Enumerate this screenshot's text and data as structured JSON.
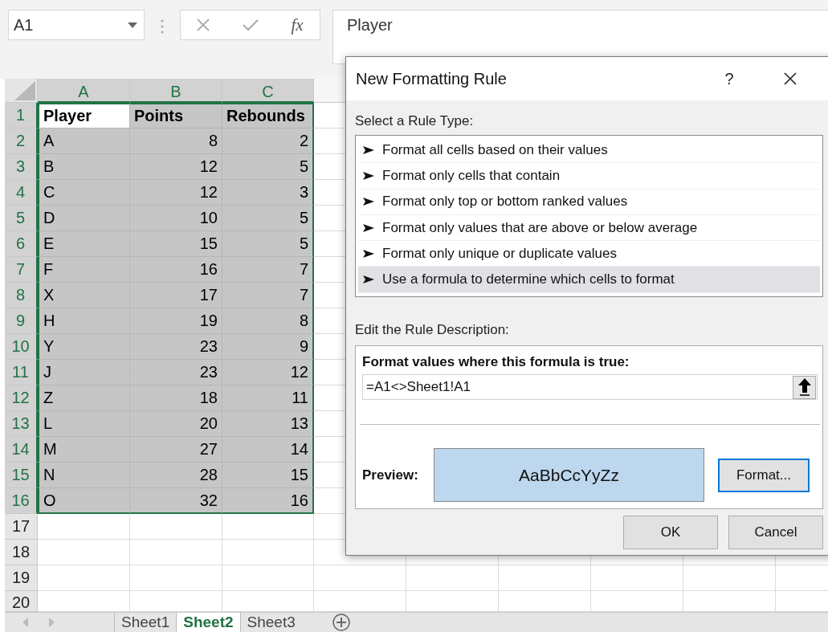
{
  "name_box": {
    "value": "A1"
  },
  "formula_bar": {
    "function_label": "fx",
    "value": "Player"
  },
  "sheet": {
    "columns": [
      {
        "label": "A",
        "selected": true
      },
      {
        "label": "B",
        "selected": true
      },
      {
        "label": "C",
        "selected": true
      }
    ],
    "rows": [
      {
        "number": "1",
        "selected": true,
        "kind": "header",
        "cells": [
          {
            "text": "Player",
            "kind": "text",
            "active": true
          },
          {
            "text": "Points",
            "kind": "text",
            "active": false
          },
          {
            "text": "Rebounds",
            "kind": "text",
            "active": false
          }
        ]
      },
      {
        "number": "2",
        "selected": true,
        "kind": "data",
        "cells": [
          {
            "text": "A",
            "kind": "text",
            "active": false
          },
          {
            "text": "8",
            "kind": "number",
            "active": false
          },
          {
            "text": "2",
            "kind": "number",
            "active": false
          }
        ]
      },
      {
        "number": "3",
        "selected": true,
        "kind": "data",
        "cells": [
          {
            "text": "B",
            "kind": "text",
            "active": false
          },
          {
            "text": "12",
            "kind": "number",
            "active": false
          },
          {
            "text": "5",
            "kind": "number",
            "active": false
          }
        ]
      },
      {
        "number": "4",
        "selected": true,
        "kind": "data",
        "cells": [
          {
            "text": "C",
            "kind": "text",
            "active": false
          },
          {
            "text": "12",
            "kind": "number",
            "active": false
          },
          {
            "text": "3",
            "kind": "number",
            "active": false
          }
        ]
      },
      {
        "number": "5",
        "selected": true,
        "kind": "data",
        "cells": [
          {
            "text": "D",
            "kind": "text",
            "active": false
          },
          {
            "text": "10",
            "kind": "number",
            "active": false
          },
          {
            "text": "5",
            "kind": "number",
            "active": false
          }
        ]
      },
      {
        "number": "6",
        "selected": true,
        "kind": "data",
        "cells": [
          {
            "text": "E",
            "kind": "text",
            "active": false
          },
          {
            "text": "15",
            "kind": "number",
            "active": false
          },
          {
            "text": "5",
            "kind": "number",
            "active": false
          }
        ]
      },
      {
        "number": "7",
        "selected": true,
        "kind": "data",
        "cells": [
          {
            "text": "F",
            "kind": "text",
            "active": false
          },
          {
            "text": "16",
            "kind": "number",
            "active": false
          },
          {
            "text": "7",
            "kind": "number",
            "active": false
          }
        ]
      },
      {
        "number": "8",
        "selected": true,
        "kind": "data",
        "cells": [
          {
            "text": "X",
            "kind": "text",
            "active": false
          },
          {
            "text": "17",
            "kind": "number",
            "active": false
          },
          {
            "text": "7",
            "kind": "number",
            "active": false
          }
        ]
      },
      {
        "number": "9",
        "selected": true,
        "kind": "data",
        "cells": [
          {
            "text": "H",
            "kind": "text",
            "active": false
          },
          {
            "text": "19",
            "kind": "number",
            "active": false
          },
          {
            "text": "8",
            "kind": "number",
            "active": false
          }
        ]
      },
      {
        "number": "10",
        "selected": true,
        "kind": "data",
        "cells": [
          {
            "text": "Y",
            "kind": "text",
            "active": false
          },
          {
            "text": "23",
            "kind": "number",
            "active": false
          },
          {
            "text": "9",
            "kind": "number",
            "active": false
          }
        ]
      },
      {
        "number": "11",
        "selected": true,
        "kind": "data",
        "cells": [
          {
            "text": "J",
            "kind": "text",
            "active": false
          },
          {
            "text": "23",
            "kind": "number",
            "active": false
          },
          {
            "text": "12",
            "kind": "number",
            "active": false
          }
        ]
      },
      {
        "number": "12",
        "selected": true,
        "kind": "data",
        "cells": [
          {
            "text": "Z",
            "kind": "text",
            "active": false
          },
          {
            "text": "18",
            "kind": "number",
            "active": false
          },
          {
            "text": "11",
            "kind": "number",
            "active": false
          }
        ]
      },
      {
        "number": "13",
        "selected": true,
        "kind": "data",
        "cells": [
          {
            "text": "L",
            "kind": "text",
            "active": false
          },
          {
            "text": "20",
            "kind": "number",
            "active": false
          },
          {
            "text": "13",
            "kind": "number",
            "active": false
          }
        ]
      },
      {
        "number": "14",
        "selected": true,
        "kind": "data",
        "cells": [
          {
            "text": "M",
            "kind": "text",
            "active": false
          },
          {
            "text": "27",
            "kind": "number",
            "active": false
          },
          {
            "text": "14",
            "kind": "number",
            "active": false
          }
        ]
      },
      {
        "number": "15",
        "selected": true,
        "kind": "data",
        "cells": [
          {
            "text": "N",
            "kind": "text",
            "active": false
          },
          {
            "text": "28",
            "kind": "number",
            "active": false
          },
          {
            "text": "15",
            "kind": "number",
            "active": false
          }
        ]
      },
      {
        "number": "16",
        "selected": true,
        "kind": "data",
        "cells": [
          {
            "text": "O",
            "kind": "text",
            "active": false
          },
          {
            "text": "32",
            "kind": "number",
            "active": false
          },
          {
            "text": "16",
            "kind": "number",
            "active": false
          }
        ]
      },
      {
        "number": "17",
        "selected": false
      },
      {
        "number": "18",
        "selected": false
      },
      {
        "number": "19",
        "selected": false
      },
      {
        "number": "20",
        "selected": false
      }
    ]
  },
  "sheet_tabs": [
    {
      "label": "Sheet1",
      "selected": false
    },
    {
      "label": "Sheet2",
      "selected": true
    },
    {
      "label": "Sheet3",
      "selected": false
    }
  ],
  "dialog": {
    "title": "New Formatting Rule",
    "help": "?",
    "rule_type_label": "Select a Rule Type:",
    "rule_types": [
      {
        "label": "Format all cells based on their values",
        "selected": false
      },
      {
        "label": "Format only cells that contain",
        "selected": false
      },
      {
        "label": "Format only top or bottom ranked values",
        "selected": false
      },
      {
        "label": "Format only values that are above or below average",
        "selected": false
      },
      {
        "label": "Format only unique or duplicate values",
        "selected": false
      },
      {
        "label": "Use a formula to determine which cells to format",
        "selected": true
      }
    ],
    "description_label": "Edit the Rule Description:",
    "formula_label": "Format values where this formula is true:",
    "formula": "=A1<>Sheet1!A1",
    "preview_label": "Preview:",
    "preview_text": "AaBbCcYyZz",
    "format_button": "Format...",
    "ok_button": "OK",
    "cancel_button": "Cancel"
  }
}
